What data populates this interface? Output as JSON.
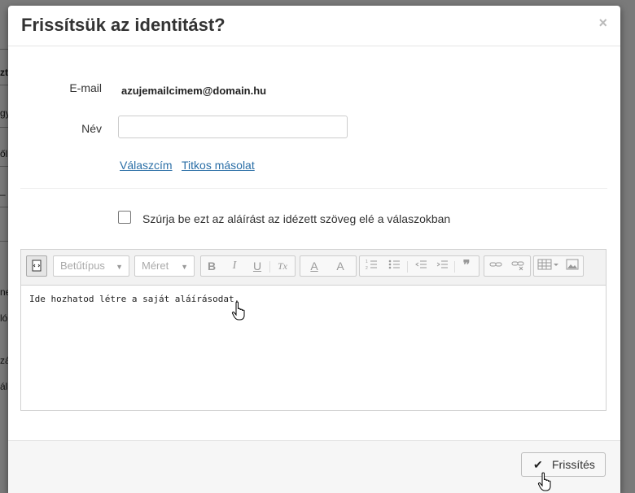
{
  "dialog": {
    "title": "Frissítsük az identitást?",
    "close_label": "×"
  },
  "form": {
    "email_label": "E-mail",
    "email_value": "azujemailcimem@domain.hu",
    "name_label": "Név",
    "name_value": "",
    "reply_to_link": "Válaszcím",
    "bcc_link": "Titkos másolat",
    "insert_signature_label": "Szúrja be ezt az aláírást az idézett szöveg elé a válaszokban",
    "insert_signature_checked": false
  },
  "editor": {
    "font_family_placeholder": "Betűtípus",
    "font_size_placeholder": "Méret",
    "toolbar_buttons": {
      "bold": "B",
      "italic": "I",
      "underline": "U",
      "remove_format": "Tx",
      "text_color": "A",
      "bg_color": "A"
    },
    "content": "Ide hozhatod létre a saját aláírásodat."
  },
  "footer": {
    "update_button": "Frissítés",
    "update_icon": "check-icon"
  },
  "background": {
    "fragments": [
      "zt",
      "gy",
      "ől",
      "–",
      "ne",
      "ló",
      "zá",
      "ála"
    ]
  }
}
